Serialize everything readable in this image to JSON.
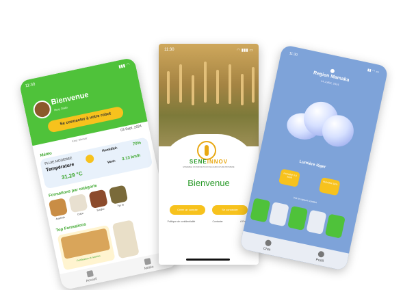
{
  "left_app": {
    "status_time": "11:30",
    "greeting": "Bienvenue",
    "subtitle": "Mery Diallo",
    "robot_button": "Se connecter à votre robot",
    "location": "Keur Massar",
    "date": "03 Sept, 2024",
    "meteo_label": "Météo",
    "weather_condition": "PLUIE MODEREE",
    "temperature_label": "Température",
    "temperature_value": "31.29 °C",
    "humidity_label": "Humidité:",
    "humidity_value": "70%",
    "wind_label": "Vent:",
    "wind_value": "3.13 km/h",
    "categories_label": "Formations par catégorie",
    "categories": [
      "Arachide",
      "Coton",
      "Sorgho",
      "Tye fo"
    ],
    "top_label": "Top Formations",
    "top_card_title": "Fertilisation et nutrition",
    "nav": [
      "Accueil",
      "Météo"
    ]
  },
  "center_app": {
    "status_time": "11:30",
    "logo_text_a": "SENE",
    "logo_text_b": "INNOV",
    "tagline": "ENSEMBLE ON INNOVE POUR UNE AGRICULTURE PROSPERE",
    "title": "Bienvenue",
    "create_account_button": "Créer un compte",
    "login_button": "Se connecter",
    "links": [
      "Politique de confidentialité",
      "Contacter",
      "À Propos"
    ]
  },
  "right_app": {
    "status_time": "11:30",
    "region": "Region Mamaka",
    "date": "14 Juillet, 2024",
    "condition": "Lumière léger",
    "chips": [
      "Humidité 0.8 km/h",
      "Humidité 54%"
    ],
    "forecast_label": "Voir le rapport complet",
    "nav": [
      "Chat",
      "Profil"
    ]
  },
  "colors": {
    "green": "#4fc23a",
    "yellow": "#f7c21d",
    "sky": "#7ea3d9"
  }
}
